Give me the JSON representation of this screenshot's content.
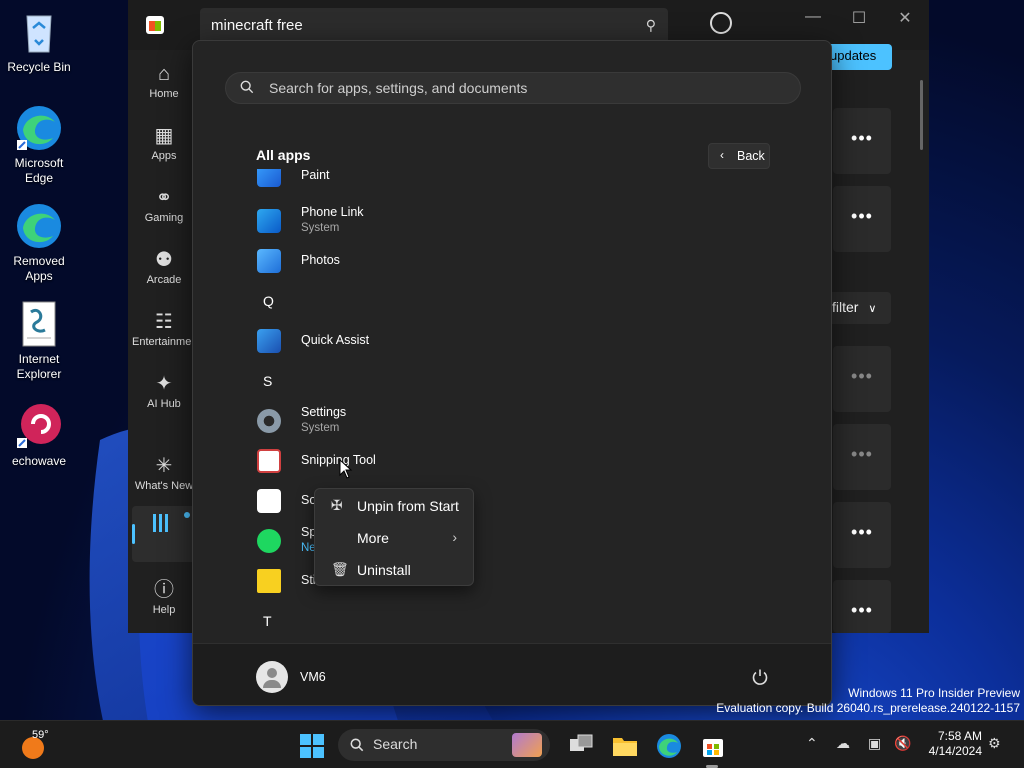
{
  "desktop": {
    "icons": [
      {
        "label": "Recycle Bin"
      },
      {
        "label": "Microsoft Edge"
      },
      {
        "label": "Removed Apps"
      },
      {
        "label": "Internet Explorer"
      },
      {
        "label": "echowave"
      }
    ]
  },
  "store": {
    "search_value": "minecraft free",
    "nav": [
      {
        "label": "Home",
        "icon": "home-icon"
      },
      {
        "label": "Apps",
        "icon": "apps-icon"
      },
      {
        "label": "Gaming",
        "icon": "gamepad-icon"
      },
      {
        "label": "Arcade",
        "icon": "joystick-icon"
      },
      {
        "label": "Entertainment",
        "icon": "clapperboard-icon"
      },
      {
        "label": "AI Hub",
        "icon": "sparkle-icon"
      },
      {
        "label": "What's New",
        "icon": "party-icon"
      },
      {
        "label": "Help",
        "icon": "help-icon"
      }
    ],
    "updates_button": "updates",
    "filter_button": "filter",
    "more_glyph": "•••"
  },
  "start_menu": {
    "search_placeholder": "Search for apps, settings, and documents",
    "all_apps_title": "All apps",
    "back_label": "Back",
    "apps": [
      {
        "name": "Paint",
        "sub": ""
      },
      {
        "name": "Phone Link",
        "sub": "System"
      },
      {
        "name": "Photos",
        "sub": ""
      },
      {
        "letter": "Q"
      },
      {
        "name": "Quick Assist",
        "sub": ""
      },
      {
        "letter": "S"
      },
      {
        "name": "Settings",
        "sub": "System"
      },
      {
        "name": "Snipping Tool",
        "sub": ""
      },
      {
        "name": "So",
        "sub": ""
      },
      {
        "name": "Sp",
        "sub": "Ne"
      },
      {
        "name": "Sti",
        "sub": ""
      },
      {
        "letter": "T"
      }
    ],
    "user_name": "VM6"
  },
  "context_menu": {
    "items": [
      {
        "label": "Unpin from Start",
        "icon": "unpin-icon"
      },
      {
        "label": "More",
        "icon": "",
        "submenu": true
      },
      {
        "label": "Uninstall",
        "icon": "trash-icon"
      }
    ]
  },
  "watermark": {
    "line1": "Windows 11 Pro Insider Preview",
    "line2": "Evaluation copy. Build 26040.rs_prerelease.240122-1157"
  },
  "taskbar": {
    "weather_temp": "59°",
    "search_label": "Search",
    "time": "7:58 AM",
    "date": "4/14/2024",
    "accent_color": "#4cc2ff"
  }
}
